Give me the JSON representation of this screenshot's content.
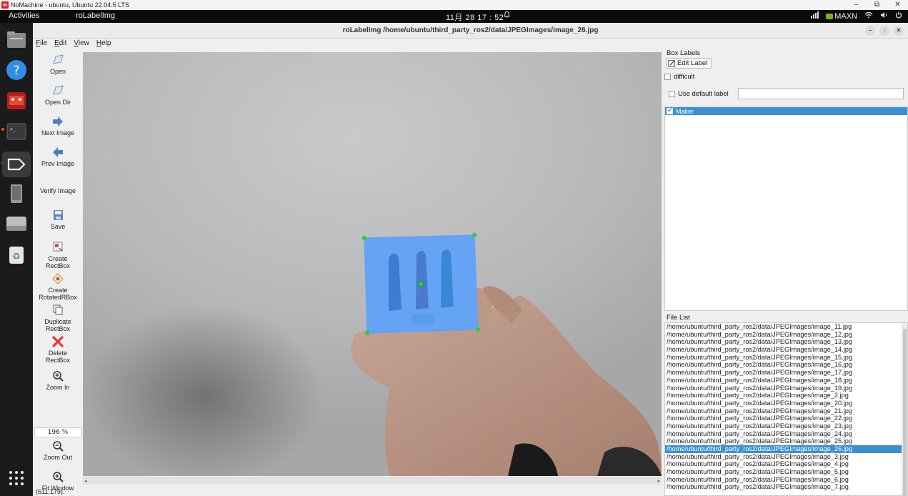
{
  "host_bar": {
    "title": "NoMachine - ubuntu, Ubuntu 22.04.5 LTS",
    "logo": "m",
    "minimize": "–",
    "restore": "⧉",
    "close": "✕"
  },
  "gnome_bar": {
    "activities": "Activities",
    "app_name": "roLabelImg",
    "clock": "11月 28  17 : 52",
    "maxn": "MAXN"
  },
  "window": {
    "title": "roLabelImg /home/ubuntu/third_party_ros2/data/JPEGImages/image_26.jpg"
  },
  "menu": {
    "file": "File",
    "edit": "Edit",
    "view": "View",
    "help": "Help"
  },
  "toolbar": {
    "open": "Open",
    "open_dir": "Open Dir",
    "next_image": "Next Image",
    "prev_image": "Prev Image",
    "verify_image": "Verify Image",
    "save": "Save",
    "create_rectbox": "Create\nRectBox",
    "create_rotated": "Create\nRotatedRBox",
    "duplicate_rectbox": "Duplicate\nRectBox",
    "delete_rectbox": "Delete\nRectBox",
    "zoom_in": "Zoom In",
    "zoom_value": "196 %",
    "zoom_out": "Zoom Out",
    "fit_window": "Fit Window"
  },
  "status": {
    "coords": "(611,179)."
  },
  "right_panel": {
    "box_labels_title": "Box Labels",
    "edit_label": "Edit Label",
    "difficult": "difficult",
    "use_default_label": "Use default label",
    "default_label_value": "",
    "labels": [
      {
        "name": "Maker",
        "checked": true
      }
    ],
    "file_list_title": "File List",
    "files": [
      "/home/ubuntu/third_party_ros2/data/JPEGImages/image_11.jpg",
      "/home/ubuntu/third_party_ros2/data/JPEGImages/image_12.jpg",
      "/home/ubuntu/third_party_ros2/data/JPEGImages/image_13.jpg",
      "/home/ubuntu/third_party_ros2/data/JPEGImages/image_14.jpg",
      "/home/ubuntu/third_party_ros2/data/JPEGImages/image_15.jpg",
      "/home/ubuntu/third_party_ros2/data/JPEGImages/image_16.jpg",
      "/home/ubuntu/third_party_ros2/data/JPEGImages/image_17.jpg",
      "/home/ubuntu/third_party_ros2/data/JPEGImages/image_18.jpg",
      "/home/ubuntu/third_party_ros2/data/JPEGImages/image_19.jpg",
      "/home/ubuntu/third_party_ros2/data/JPEGImages/image_2.jpg",
      "/home/ubuntu/third_party_ros2/data/JPEGImages/image_20.jpg",
      "/home/ubuntu/third_party_ros2/data/JPEGImages/image_21.jpg",
      "/home/ubuntu/third_party_ros2/data/JPEGImages/image_22.jpg",
      "/home/ubuntu/third_party_ros2/data/JPEGImages/image_23.jpg",
      "/home/ubuntu/third_party_ros2/data/JPEGImages/image_24.jpg",
      "/home/ubuntu/third_party_ros2/data/JPEGImages/image_25.jpg",
      "/home/ubuntu/third_party_ros2/data/JPEGImages/image_26.jpg",
      "/home/ubuntu/third_party_ros2/data/JPEGImages/image_3.jpg",
      "/home/ubuntu/third_party_ros2/data/JPEGImages/image_4.jpg",
      "/home/ubuntu/third_party_ros2/data/JPEGImages/image_5.jpg",
      "/home/ubuntu/third_party_ros2/data/JPEGImages/image_6.jpg",
      "/home/ubuntu/third_party_ros2/data/JPEGImages/image_7.jpg"
    ],
    "selected_file_index": 16
  },
  "colors": {
    "selection": "#3b8fd6",
    "box_fill": "#3d8ef5",
    "handle": "#2ecc40"
  },
  "dock_icons": [
    "files-icon",
    "help-icon",
    "image-viewer-icon",
    "terminal-icon",
    "rolabelimg-icon",
    "tablet-icon",
    "drive-icon",
    "trash-icon",
    "apps-grid-icon"
  ]
}
